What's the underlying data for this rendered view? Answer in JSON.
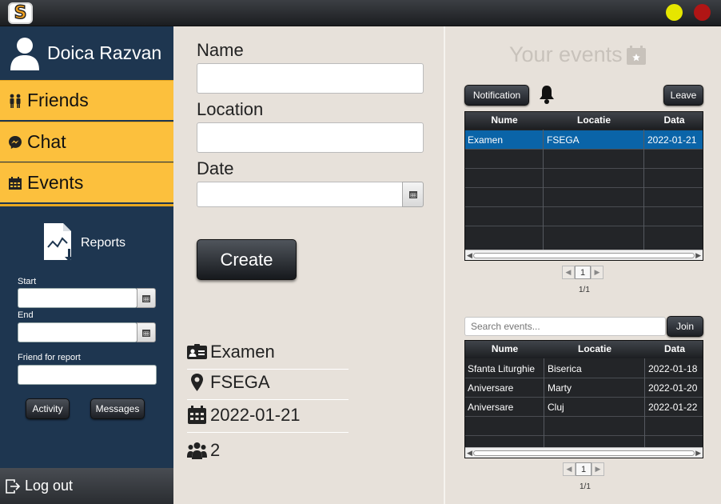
{
  "app": {
    "logo_letter": "S",
    "minimize_color": "#e6e600",
    "close_color": "#b01515"
  },
  "sidebar": {
    "user_name": "Doica Razvan",
    "nav": [
      {
        "label": "Friends",
        "icon": "friends-icon"
      },
      {
        "label": "Chat",
        "icon": "messenger-icon"
      },
      {
        "label": "Events",
        "icon": "calendar-icon"
      }
    ],
    "reports": {
      "title": "Reports",
      "start_label": "Start",
      "end_label": "End",
      "friend_label": "Friend for report",
      "activity_button": "Activity",
      "messages_button": "Messages"
    },
    "logout_label": "Log out",
    "accent_color": "#fcc03d",
    "background_color": "#1e3650"
  },
  "form": {
    "name_label": "Name",
    "location_label": "Location",
    "date_label": "Date",
    "create_button": "Create"
  },
  "details": {
    "name": "Examen",
    "location": "FSEGA",
    "date": "2022-01-21",
    "participants": "2"
  },
  "your_events": {
    "title": "Your events",
    "notification_button": "Notification",
    "leave_button": "Leave",
    "columns": [
      "Nume",
      "Locatie",
      "Data"
    ],
    "rows": [
      {
        "nume": "Examen",
        "locatie": "FSEGA",
        "data": "2022-01-21"
      }
    ],
    "page": "1",
    "page_info": "1/1"
  },
  "all_events": {
    "search_placeholder": "Search events...",
    "join_button": "Join",
    "columns": [
      "Nume",
      "Locatie",
      "Data"
    ],
    "rows": [
      {
        "nume": "Sfanta Liturghie",
        "locatie": "Biserica",
        "data": "2022-01-18"
      },
      {
        "nume": "Aniversare",
        "locatie": "Marty",
        "data": "2022-01-20"
      },
      {
        "nume": "Aniversare",
        "locatie": "Cluj",
        "data": "2022-01-22"
      }
    ],
    "page": "1",
    "page_info": "1/1"
  }
}
